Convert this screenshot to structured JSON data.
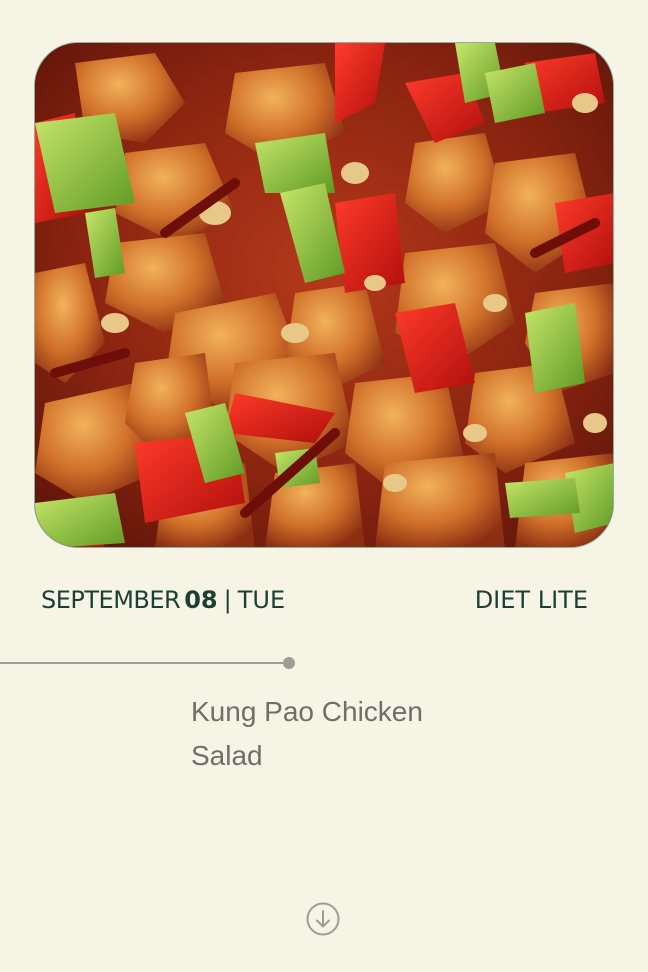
{
  "hero": {
    "image_alt": "Kung Pao Chicken dish"
  },
  "date": {
    "month": "SEPTEMBER",
    "day": "08",
    "separator": "|",
    "weekday": "TUE"
  },
  "plan": {
    "label": "DIET LITE"
  },
  "meal": {
    "name": "Kung Pao Chicken Salad"
  },
  "icons": {
    "scroll_down": "arrow-down-circle-icon"
  },
  "colors": {
    "background": "#f6f4e4",
    "text_dark": "#1c3e35",
    "text_muted": "#6f6f6a",
    "timeline": "#9d9d97"
  }
}
